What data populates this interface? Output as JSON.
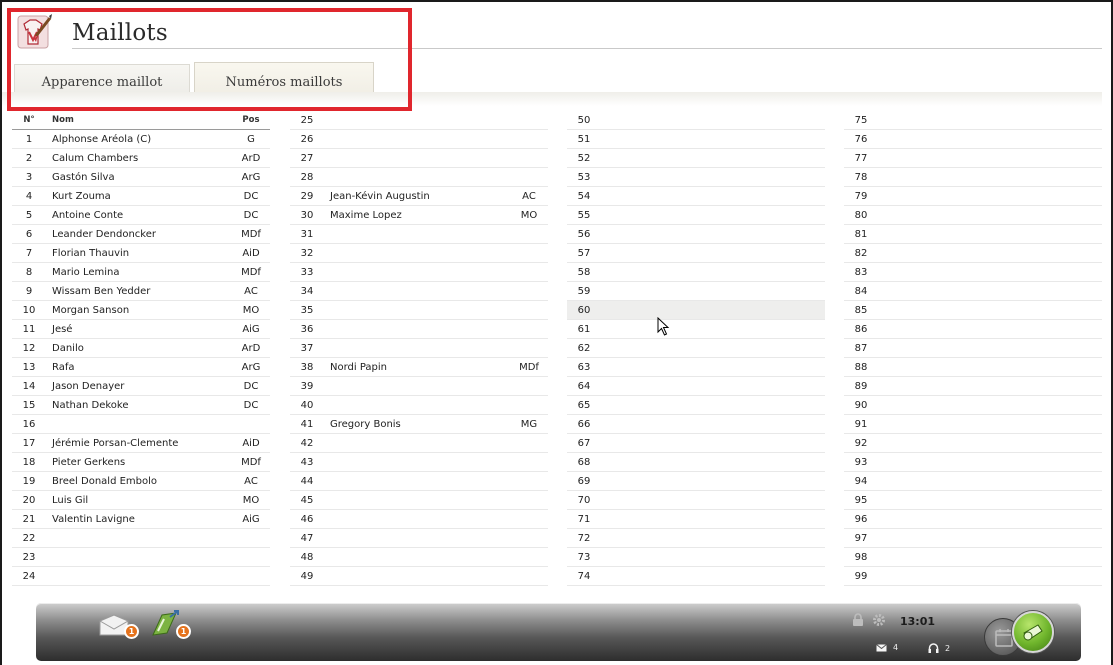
{
  "header": {
    "title": "Maillots",
    "app_icon": "jersey-paintbrush-icon"
  },
  "tabs": [
    {
      "label": "Apparence maillot",
      "active": false
    },
    {
      "label": "Numéros maillots",
      "active": true
    }
  ],
  "table": {
    "columns": {
      "num": "N°",
      "name": "Nom",
      "pos": "Pos"
    },
    "col1": [
      {
        "num": "1",
        "name": "Alphonse Aréola (C)",
        "pos": "G"
      },
      {
        "num": "2",
        "name": "Calum Chambers",
        "pos": "ArD"
      },
      {
        "num": "3",
        "name": "Gastón Silva",
        "pos": "ArG"
      },
      {
        "num": "4",
        "name": "Kurt Zouma",
        "pos": "DC"
      },
      {
        "num": "5",
        "name": "Antoine Conte",
        "pos": "DC"
      },
      {
        "num": "6",
        "name": "Leander Dendoncker",
        "pos": "MDf"
      },
      {
        "num": "7",
        "name": "Florian Thauvin",
        "pos": "AiD"
      },
      {
        "num": "8",
        "name": "Mario Lemina",
        "pos": "MDf"
      },
      {
        "num": "9",
        "name": "Wissam Ben Yedder",
        "pos": "AC"
      },
      {
        "num": "10",
        "name": "Morgan Sanson",
        "pos": "MO"
      },
      {
        "num": "11",
        "name": "Jesé",
        "pos": "AiG"
      },
      {
        "num": "12",
        "name": "Danilo",
        "pos": "ArD"
      },
      {
        "num": "13",
        "name": "Rafa",
        "pos": "ArG"
      },
      {
        "num": "14",
        "name": "Jason Denayer",
        "pos": "DC"
      },
      {
        "num": "15",
        "name": "Nathan Dekoke",
        "pos": "DC"
      },
      {
        "num": "16",
        "name": "",
        "pos": ""
      },
      {
        "num": "17",
        "name": "Jérémie Porsan-Clemente",
        "pos": "AiD"
      },
      {
        "num": "18",
        "name": "Pieter Gerkens",
        "pos": "MDf"
      },
      {
        "num": "19",
        "name": "Breel Donald Embolo",
        "pos": "AC"
      },
      {
        "num": "20",
        "name": "Luis Gil",
        "pos": "MO"
      },
      {
        "num": "21",
        "name": "Valentin Lavigne",
        "pos": "AiG"
      },
      {
        "num": "22",
        "name": "",
        "pos": ""
      },
      {
        "num": "23",
        "name": "",
        "pos": ""
      },
      {
        "num": "24",
        "name": "",
        "pos": ""
      }
    ],
    "col2": [
      {
        "num": "25",
        "name": "",
        "pos": ""
      },
      {
        "num": "26",
        "name": "",
        "pos": ""
      },
      {
        "num": "27",
        "name": "",
        "pos": ""
      },
      {
        "num": "28",
        "name": "",
        "pos": ""
      },
      {
        "num": "29",
        "name": "Jean-Kévin Augustin",
        "pos": "AC"
      },
      {
        "num": "30",
        "name": "Maxime Lopez",
        "pos": "MO"
      },
      {
        "num": "31",
        "name": "",
        "pos": ""
      },
      {
        "num": "32",
        "name": "",
        "pos": ""
      },
      {
        "num": "33",
        "name": "",
        "pos": ""
      },
      {
        "num": "34",
        "name": "",
        "pos": ""
      },
      {
        "num": "35",
        "name": "",
        "pos": ""
      },
      {
        "num": "36",
        "name": "",
        "pos": ""
      },
      {
        "num": "37",
        "name": "",
        "pos": ""
      },
      {
        "num": "38",
        "name": "Nordi Papin",
        "pos": "MDf"
      },
      {
        "num": "39",
        "name": "",
        "pos": ""
      },
      {
        "num": "40",
        "name": "",
        "pos": ""
      },
      {
        "num": "41",
        "name": "Gregory Bonis",
        "pos": "MG"
      },
      {
        "num": "42",
        "name": "",
        "pos": ""
      },
      {
        "num": "43",
        "name": "",
        "pos": ""
      },
      {
        "num": "44",
        "name": "",
        "pos": ""
      },
      {
        "num": "45",
        "name": "",
        "pos": ""
      },
      {
        "num": "46",
        "name": "",
        "pos": ""
      },
      {
        "num": "47",
        "name": "",
        "pos": ""
      },
      {
        "num": "48",
        "name": "",
        "pos": ""
      },
      {
        "num": "49",
        "name": "",
        "pos": ""
      }
    ],
    "col3": [
      "50",
      "51",
      "52",
      "53",
      "54",
      "55",
      "56",
      "57",
      "58",
      "59",
      "60",
      "61",
      "62",
      "63",
      "64",
      "65",
      "66",
      "67",
      "68",
      "69",
      "70",
      "71",
      "72",
      "73",
      "74"
    ],
    "col4": [
      "75",
      "76",
      "77",
      "78",
      "79",
      "80",
      "81",
      "82",
      "83",
      "84",
      "85",
      "86",
      "87",
      "88",
      "89",
      "90",
      "91",
      "92",
      "93",
      "94",
      "95",
      "96",
      "97",
      "98",
      "99"
    ],
    "hovered_row": "60"
  },
  "bottom_bar": {
    "mail_icon": "envelope-icon",
    "mail_badge": "1",
    "transfer_icon": "transfer-icon",
    "transfer_badge": "1",
    "lock_icon": "lock-icon",
    "settings_icon": "gear-icon",
    "time": "13:01",
    "messages_count": "4",
    "support_count": "2",
    "calendar_icon": "calendar-icon",
    "continue_icon": "whistle-icon",
    "accent_color": "#6fb52c",
    "badge_color": "#e5731d"
  }
}
